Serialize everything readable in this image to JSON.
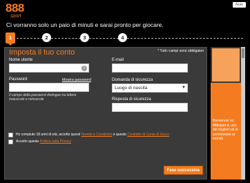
{
  "brand": {
    "logo_number": "888",
    "logo_sub": "sport"
  },
  "help_button": "Aiuto",
  "tagline": "Ci vorranno solo un paio di minuti e sarai pronto per giocare.",
  "steps": [
    "1",
    "2",
    "3",
    "4"
  ],
  "form": {
    "title": "Imposta il tuo conto",
    "required_note": "* Tutti i campi sono obbligatori",
    "username_label": "Nome utente",
    "password_label": "Password",
    "show_password": "Mostra password",
    "password_hint": "Il campo della password distingue tra lettere maiuscole e minuscole",
    "email_label": "E-mail",
    "security_question_label": "Domanda di sicurezza",
    "security_question_value": "Luogo di nascita",
    "security_answer_label": "Risposta di sicurezza",
    "terms_prefix": "Ho compiuto 18 anni di età, accetto questi ",
    "terms_link": "Termini e Condizioni",
    "terms_middle": " e questo ",
    "contract_link": "Contratto di Conto di Gioco",
    "privacy_prefix": "Accetto questa ",
    "privacy_link": "Politica sulla Privacy",
    "next_button": "Fase successiva"
  },
  "promo": {
    "text": "Benvenuto su 888sport.it, uno dei migliori siti di scommesse al mondo"
  }
}
